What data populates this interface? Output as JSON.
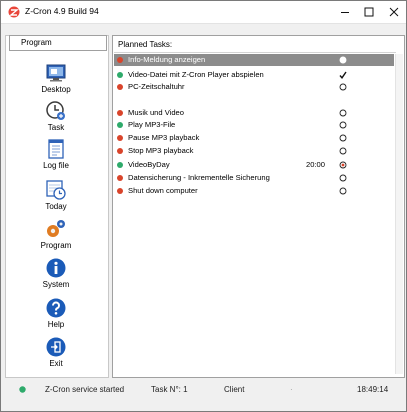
{
  "window": {
    "title": "Z-Cron 4.9 Build 94"
  },
  "sidebar": {
    "header": "Program",
    "items": [
      {
        "label": "Desktop",
        "icon": "desktop-icon"
      },
      {
        "label": "Task",
        "icon": "clock-icon"
      },
      {
        "label": "Log file",
        "icon": "log-file-icon"
      },
      {
        "label": "Today",
        "icon": "calendar-clock-icon"
      },
      {
        "label": "Program",
        "icon": "gears-icon"
      },
      {
        "label": "System",
        "icon": "info-icon"
      },
      {
        "label": "Help",
        "icon": "help-icon"
      },
      {
        "label": "Exit",
        "icon": "exit-icon"
      }
    ]
  },
  "tasks": {
    "header": "Planned Tasks:",
    "rows": [
      {
        "name": "Info-Meldung anzeigen",
        "time": "",
        "status": "circle",
        "dot": "#d9442b",
        "selected": true
      },
      {
        "name": "Video-Datei mit Z-Cron Player abspielen",
        "time": "",
        "status": "check",
        "dot": "#2eaa6b",
        "selected": false
      },
      {
        "name": "PC-Zeitschaltuhr",
        "time": "",
        "status": "circle",
        "dot": "#d9442b",
        "selected": false
      },
      {
        "name": "Musik und Video",
        "time": "",
        "status": "circle",
        "dot": "#d9442b",
        "selected": false
      },
      {
        "name": "Play MP3-File",
        "time": "",
        "status": "circle",
        "dot": "#2eaa6b",
        "selected": false
      },
      {
        "name": "Pause MP3 playback",
        "time": "",
        "status": "circle",
        "dot": "#d9442b",
        "selected": false
      },
      {
        "name": "Stop MP3 playback",
        "time": "",
        "status": "circle",
        "dot": "#d9442b",
        "selected": false
      },
      {
        "name": "VideoByDay",
        "time": "20:00",
        "status": "target",
        "dot": "#2eaa6b",
        "selected": false
      },
      {
        "name": "Datensicherung - Inkrementelle Sicherung",
        "time": "",
        "status": "circle",
        "dot": "#d9442b",
        "selected": false
      },
      {
        "name": "Shut down computer",
        "time": "",
        "status": "circle",
        "dot": "#d9442b",
        "selected": false
      }
    ]
  },
  "statusbar": {
    "message": "Z-Cron service started",
    "task_no": "Task N°: 1",
    "client": "Client",
    "time": "18:49:14"
  }
}
